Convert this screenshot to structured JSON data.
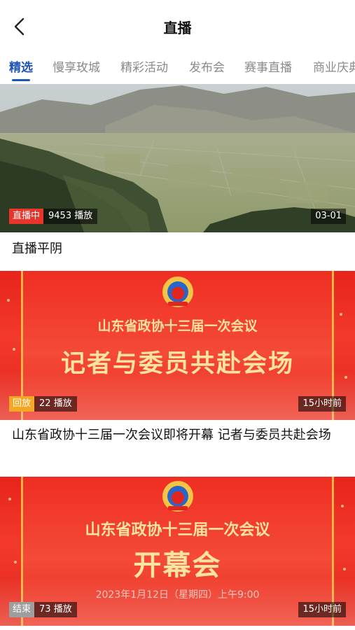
{
  "header": {
    "title": "直播",
    "back_icon": "chevron-left-icon"
  },
  "tabs": [
    {
      "label": "精选",
      "active": true
    },
    {
      "label": "慢享玫城",
      "active": false
    },
    {
      "label": "精彩活动",
      "active": false
    },
    {
      "label": "发布会",
      "active": false
    },
    {
      "label": "赛事直播",
      "active": false
    },
    {
      "label": "商业庆典",
      "active": false
    }
  ],
  "colors": {
    "accent": "#1f56b8",
    "live_badge": "#e8352c",
    "replay_badge": "#f5a623",
    "ended_badge": "#9e9e9e",
    "banner_red": "#e8231c",
    "banner_gold": "#fde3a0"
  },
  "cards": [
    {
      "status": "直播中",
      "plays": "9453",
      "plays_suffix": "播放",
      "time": "03-01",
      "title": "直播平阴"
    },
    {
      "status": "回放",
      "plays": "22",
      "plays_suffix": "播放",
      "time": "15小时前",
      "banner_sub": "山东省政协十三届一次会议",
      "banner_main": "记者与委员共赴会场",
      "title": "山东省政协十三届一次会议即将开幕  记者与委员共赴会场"
    },
    {
      "status": "结束",
      "plays": "73",
      "plays_suffix": "播放",
      "time": "15小时前",
      "banner_sub": "山东省政协十三届一次会议",
      "banner_main": "开幕会",
      "banner_date": "2023年1月12日（星期四）上午9:00"
    }
  ]
}
